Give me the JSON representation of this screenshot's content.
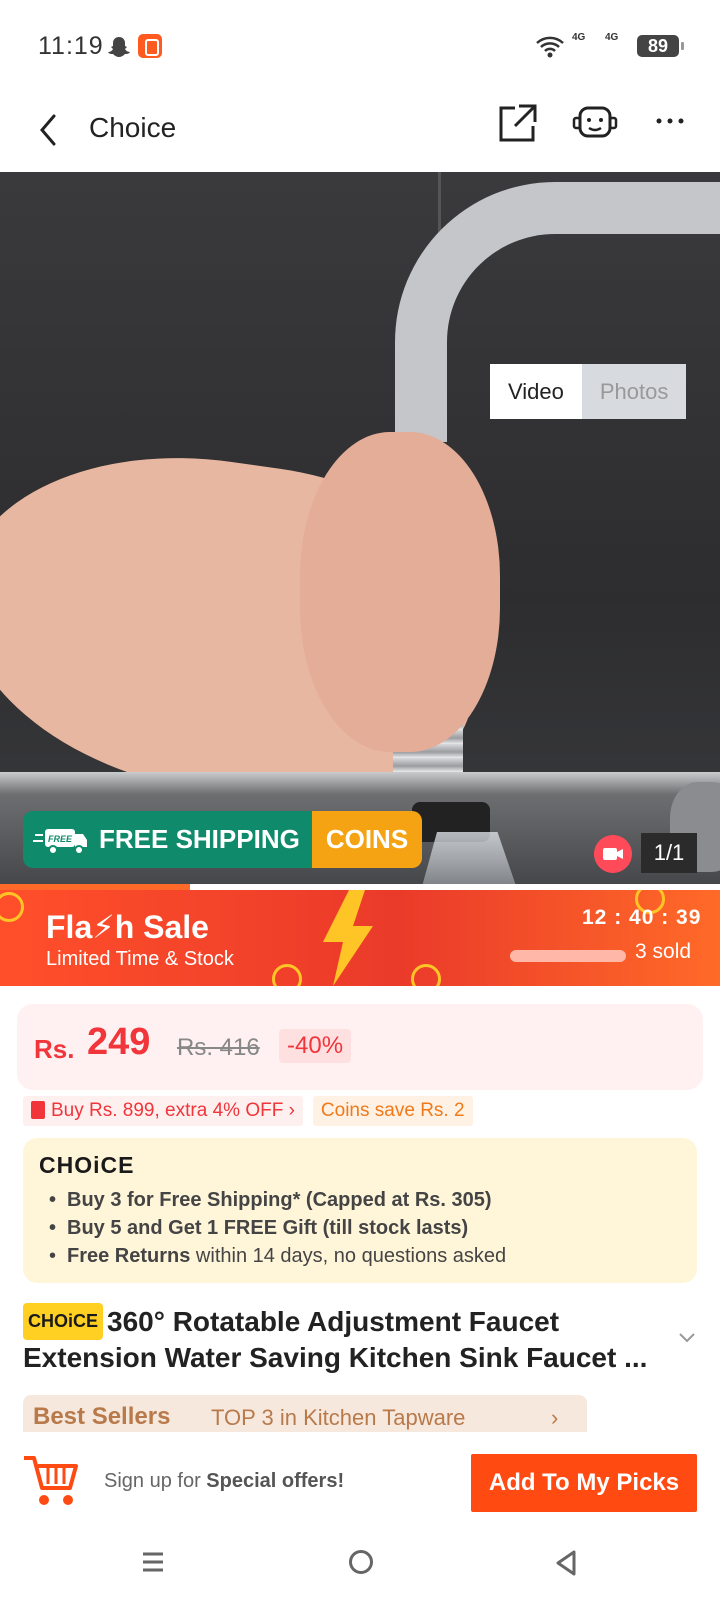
{
  "status": {
    "time": "11:19",
    "battery": "89",
    "network1": "4G",
    "network2": "4G",
    "icons": [
      "snapchat-icon",
      "app-notification-icon",
      "wifi-icon",
      "signal-icon",
      "battery-icon"
    ]
  },
  "nav": {
    "title": "Choice",
    "icons": [
      "back-icon",
      "share-icon",
      "support-icon",
      "more-icon"
    ]
  },
  "media": {
    "tab_video": "Video",
    "tab_photos": "Photos",
    "counter": "1/1",
    "ship_label": "FREE SHIPPING",
    "coins_label": "COINS",
    "free_tag": "FREE"
  },
  "flash": {
    "title": "Fla⚡h Sale",
    "subtitle": "Limited Time & Stock",
    "timer": "12 : 40 : 39",
    "sold": "3 sold"
  },
  "price": {
    "currency": "Rs.",
    "value": "249",
    "old": "Rs. 416",
    "discount": "-40%"
  },
  "promos": {
    "bundle": "Buy Rs. 899, extra 4% OFF",
    "coins": "Coins save Rs. 2"
  },
  "choice": {
    "logo": "CHOiCE",
    "line1": "Buy 3 for  Free Shipping* (Capped at Rs. 305)",
    "line2": "Buy 5 and Get 1 FREE Gift (till stock lasts)",
    "line3_bold": "Free Returns",
    "line3_rest": " within 14 days, no questions asked"
  },
  "product": {
    "tag": "CHOiCE",
    "title": "360° Rotatable Adjustment Faucet Extension Water Saving Kitchen Sink Faucet ..."
  },
  "bestsellers": {
    "title": "Best Sellers",
    "text": "TOP 3 in Kitchen Tapware",
    "chevron": "›"
  },
  "bottom": {
    "signup_prefix": "Sign up for ",
    "signup_bold": "Special offers!",
    "button": "Add To My Picks"
  },
  "colors": {
    "accent": "#ff4a12",
    "price": "#f0353b",
    "flash": "#ea3a2a",
    "shipping": "#0f8a6a",
    "coins": "#f6a313"
  }
}
